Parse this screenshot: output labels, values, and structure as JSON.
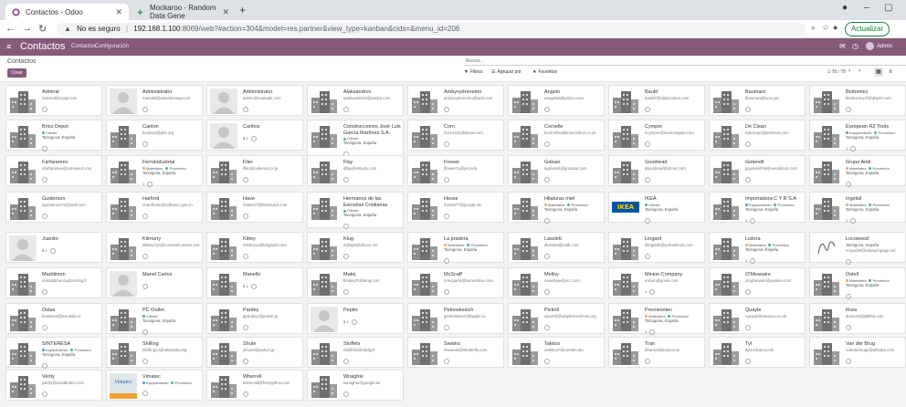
{
  "browser": {
    "tabs": [
      {
        "title": "Contactos - Odoo",
        "active": true
      },
      {
        "title": "Mockaroo - Random Data Gene",
        "active": false
      }
    ],
    "url_warning": "No es seguro",
    "url_host": "192.168.1.100",
    "url_path": ":8069/web?#action=304&model=res.partner&view_type=kanban&cids=&menu_id=206",
    "update_label": "Actualizar"
  },
  "odoo": {
    "app_title": "Contactos",
    "menu": [
      "Contactos",
      "Configuración"
    ],
    "user": "Admin"
  },
  "control": {
    "breadcrumb": "Contactos",
    "create_label": "Crear",
    "search_placeholder": "Buscar...",
    "filters_label": "Filtros",
    "groupby_label": "Agrupar por",
    "favorites_label": "Favoritos",
    "pager": "1-78 / 78"
  },
  "colors": {
    "odoo": "#875a7b",
    "tag_green": "#30c381",
    "tag_blue": "#4c9cde",
    "tag_orange": "#f7a35c"
  },
  "cards": [
    {
      "name": "Admiral",
      "email": "lsdeonl@myspl.com",
      "thumb": "company"
    },
    {
      "name": "Administrator",
      "email": "rrassafd@websitemaps.net",
      "thumb": "person"
    },
    {
      "name": "Administrator",
      "email": "admin@example.com",
      "thumb": "person"
    },
    {
      "name": "Alaksandrov",
      "email": "aalekandrov2@adobe.com",
      "thumb": "company"
    },
    {
      "name": "Ambyvydrenemo",
      "email": "ambyvydrenemo@web.com",
      "thumb": "company"
    },
    {
      "name": "Angelo",
      "email": "aangelo6@yahoo.com",
      "thumb": "company"
    },
    {
      "name": "Bauld",
      "email": "bauld7@dailymotion.com",
      "thumb": "company"
    },
    {
      "name": "Baumant",
      "email": "lbaumant@uoo.gov",
      "thumb": "company"
    },
    {
      "name": "Bottomley",
      "email": "bbottomley7l@qhpml.com",
      "thumb": "company"
    },
    {
      "name": "Brico Depot",
      "email": "",
      "tags": [
        "Cliente"
      ],
      "location": "Tarragona, España",
      "thumb": "company"
    },
    {
      "name": "Canton",
      "email": "bcanton@pbs.org",
      "thumb": "company"
    },
    {
      "name": "Carlitos",
      "email": "",
      "activity": "$ 1",
      "thumb": "person"
    },
    {
      "name": "Construcciones José Luis García Martínez S.A.",
      "email": "",
      "tags": [
        "Cliente"
      ],
      "location": "Tarragona, España",
      "thumb": "company"
    },
    {
      "name": "Corn",
      "email": "lcorn10@dlsberal.com",
      "thumb": "company"
    },
    {
      "name": "Cornelle",
      "email": "bcornel5e@timesonline.co.uk",
      "thumb": "company"
    },
    {
      "name": "Cymper",
      "email": "ecymper@invisionapps.com",
      "thumb": "company"
    },
    {
      "name": "De Clean",
      "email": "hdeclean@pinterest.com",
      "thumb": "company"
    },
    {
      "name": "European RZ Tools",
      "email": "",
      "tags": [
        "Equipamiento",
        "Proveedor"
      ],
      "location": "Tarragona, España",
      "activity": "1",
      "thumb": "company"
    },
    {
      "name": "Farfarareev",
      "email": "ofarfarareev@mlmused.com",
      "thumb": "company"
    },
    {
      "name": "Ferrolndustrial",
      "email": "",
      "tags": [
        "Materiales",
        "Proveedor"
      ],
      "location": "Tarragona, España",
      "activity": "1",
      "thumb": "company"
    },
    {
      "name": "Flier",
      "email": "lflier@cabernet.or.jp",
      "thumb": "company"
    },
    {
      "name": "Flay",
      "email": "dflay@elmyds.com",
      "thumb": "company"
    },
    {
      "name": "Frewer",
      "email": "lfrewer7u@yet.edu",
      "thumb": "company"
    },
    {
      "name": "Galvan",
      "email": "agalvan8@gravatar.com",
      "thumb": "company"
    },
    {
      "name": "Goodread",
      "email": "dgoodread@sfmer.com",
      "thumb": "company"
    },
    {
      "name": "Gotenell",
      "email": "pgotenell7el@overuliture.com",
      "thumb": "company"
    },
    {
      "name": "Grupo Aridi",
      "email": "",
      "tags": [
        "Materiales",
        "Proveedor"
      ],
      "location": "Tarragona, España",
      "thumb": "company"
    },
    {
      "name": "Guiderson",
      "email": "tgunderson74@mail.com",
      "thumb": "company"
    },
    {
      "name": "Harford",
      "email": "ohardforde@cdbaacc.gov.cn",
      "thumb": "company"
    },
    {
      "name": "Have",
      "email": "nhave17@tvasscadr.com",
      "thumb": "company"
    },
    {
      "name": "Hermanos de las Escuelas Cristianas",
      "email": "",
      "tags": [
        "Cliente"
      ],
      "location": "Tarragona, España",
      "thumb": "company"
    },
    {
      "name": "Hesse",
      "email": "rhesse77@google.de",
      "thumb": "company"
    },
    {
      "name": "Hilaturas miel",
      "email": "",
      "tags": [
        "Materiales",
        "Proveedor"
      ],
      "location": "Tarragona, España",
      "thumb": "company"
    },
    {
      "name": "IKEA",
      "email": "",
      "tags": [
        "Cliente"
      ],
      "location": "Tarragona, España",
      "thumb": "ikea",
      "logo": "IKEA"
    },
    {
      "name": "Importadora C Y R S.A",
      "email": "",
      "tags": [
        "Equipamiento",
        "Proveedor"
      ],
      "location": "Tarragona, España",
      "activity": "1",
      "thumb": "company"
    },
    {
      "name": "Ingelsil",
      "email": "",
      "tags": [
        "Materiales",
        "Proveedor"
      ],
      "location": "Tarragona, España",
      "activity": "1",
      "thumb": "company"
    },
    {
      "name": "Juanito",
      "email": "",
      "activity": "$ 1",
      "thumb": "person"
    },
    {
      "name": "Kilmurry",
      "email": "akilmurry0@constantcontact.com",
      "thumb": "company"
    },
    {
      "name": "Kittey",
      "email": "mkitteyxx@blogspot.com",
      "thumb": "company"
    },
    {
      "name": "Klug",
      "email": "mklug5@discuz.net",
      "thumb": "company"
    },
    {
      "name": "La pradera",
      "email": "",
      "tags": [
        "Materiales",
        "Proveedor"
      ],
      "location": "Tarragona, España",
      "thumb": "company"
    },
    {
      "name": "Lasslett",
      "email": "dlasslett@redli.com",
      "thumb": "company"
    },
    {
      "name": "Lingard",
      "email": "blingard6@yellowbook.com",
      "thumb": "company"
    },
    {
      "name": "Listora",
      "email": "",
      "tags": [
        "Materiales",
        "Proveedor"
      ],
      "location": "Tarragona, España",
      "activity": "1",
      "thumb": "company"
    },
    {
      "name": "Locowood",
      "email": "",
      "location": "Tarragona, España",
      "extra": "mzjuaf49@vistaprinpage.net",
      "thumb": "sig"
    },
    {
      "name": "Maddimon",
      "email": "mmaddimon1a@cvblog.fr",
      "thumb": "company"
    },
    {
      "name": "Manel Carlos",
      "email": "",
      "thumb": "person"
    },
    {
      "name": "Manello",
      "email": "",
      "activity": "$ 1",
      "thumb": "company"
    },
    {
      "name": "Matej",
      "email": "bmatej76@bing.com",
      "thumb": "company"
    },
    {
      "name": "McScaff",
      "email": "mmcgarfe@barnesbloe.com",
      "thumb": "company"
    },
    {
      "name": "Melloy",
      "email": "mmelloye@ucc.com",
      "thumb": "company"
    },
    {
      "name": "Minion Company",
      "email": "minion@gmail.com",
      "activity": "1",
      "thumb": "company"
    },
    {
      "name": "O'Measaire",
      "email": "omgheaaire@yandex.com",
      "thumb": "company"
    },
    {
      "name": "Ostell",
      "email": "",
      "tags": [
        "Materiales",
        "Proveedor"
      ],
      "location": "Tarragona, España",
      "thumb": "company"
    },
    {
      "name": "Ostas",
      "email": "bostas13@wordalix.ru",
      "thumb": "company"
    },
    {
      "name": "PC Outlet",
      "email": "",
      "tags": [
        "Cliente"
      ],
      "location": "Tarragona, España",
      "thumb": "company"
    },
    {
      "name": "Pardey",
      "email": "gpardeyx@prweb.jp",
      "thumb": "company"
    },
    {
      "name": "Pepito",
      "email": "",
      "activity": "$ 1",
      "thumb": "person"
    },
    {
      "name": "Pelnoskesich",
      "email": "jpelnoskesich@apple.ru",
      "thumb": "company"
    },
    {
      "name": "Pickrill",
      "email": "cpickrill@simplemachines.org",
      "thumb": "company"
    },
    {
      "name": "Precisiontec",
      "email": "",
      "tags": [
        "Materiales",
        "Proveedor"
      ],
      "location": "Tarragona, España",
      "activity": "1",
      "thumb": "company"
    },
    {
      "name": "Quayle",
      "email": "rquayle@amazon.co.uk",
      "thumb": "company"
    },
    {
      "name": "Russ",
      "email": "druss16@jalbtha.com",
      "thumb": "company"
    },
    {
      "name": "SINTERESA",
      "email": "",
      "tags": [
        "Equipamiento",
        "Proveedor"
      ],
      "location": "Tarragona, España",
      "thumb": "company"
    },
    {
      "name": "Shilling",
      "email": "lshilling14@wikipedia.org",
      "thumb": "company"
    },
    {
      "name": "Shute",
      "email": "jshute0@yahoo.jp",
      "thumb": "company"
    },
    {
      "name": "Stoffels",
      "email": "rstoffelst@ubdig.fr",
      "thumb": "company"
    },
    {
      "name": "Swains",
      "email": "lswains8@shutterfly.com",
      "thumb": "company"
    },
    {
      "name": "Takkos",
      "email": "otakkos7@cornell.edu",
      "thumb": "company"
    },
    {
      "name": "Tran",
      "email": "dtran10@bsslu.com",
      "thumb": "company"
    },
    {
      "name": "Tyt",
      "email": "ltyt12@amu.edu",
      "thumb": "company"
    },
    {
      "name": "Van der Brug",
      "email": "rvanderbruge@alibaba.com",
      "thumb": "company"
    },
    {
      "name": "Verity",
      "email": "jverity@scratbrains.com",
      "thumb": "company"
    },
    {
      "name": "Vimatec",
      "email": "",
      "tags": [
        "Equipamiento",
        "Proveedor"
      ],
      "thumb": "vimatec",
      "logo": "Vimatec"
    },
    {
      "name": "Wherrell",
      "email": "dwherrall@freepython.com",
      "thumb": "company"
    },
    {
      "name": "Wraighte",
      "email": "lwraighte@google.de",
      "thumb": "company"
    }
  ]
}
